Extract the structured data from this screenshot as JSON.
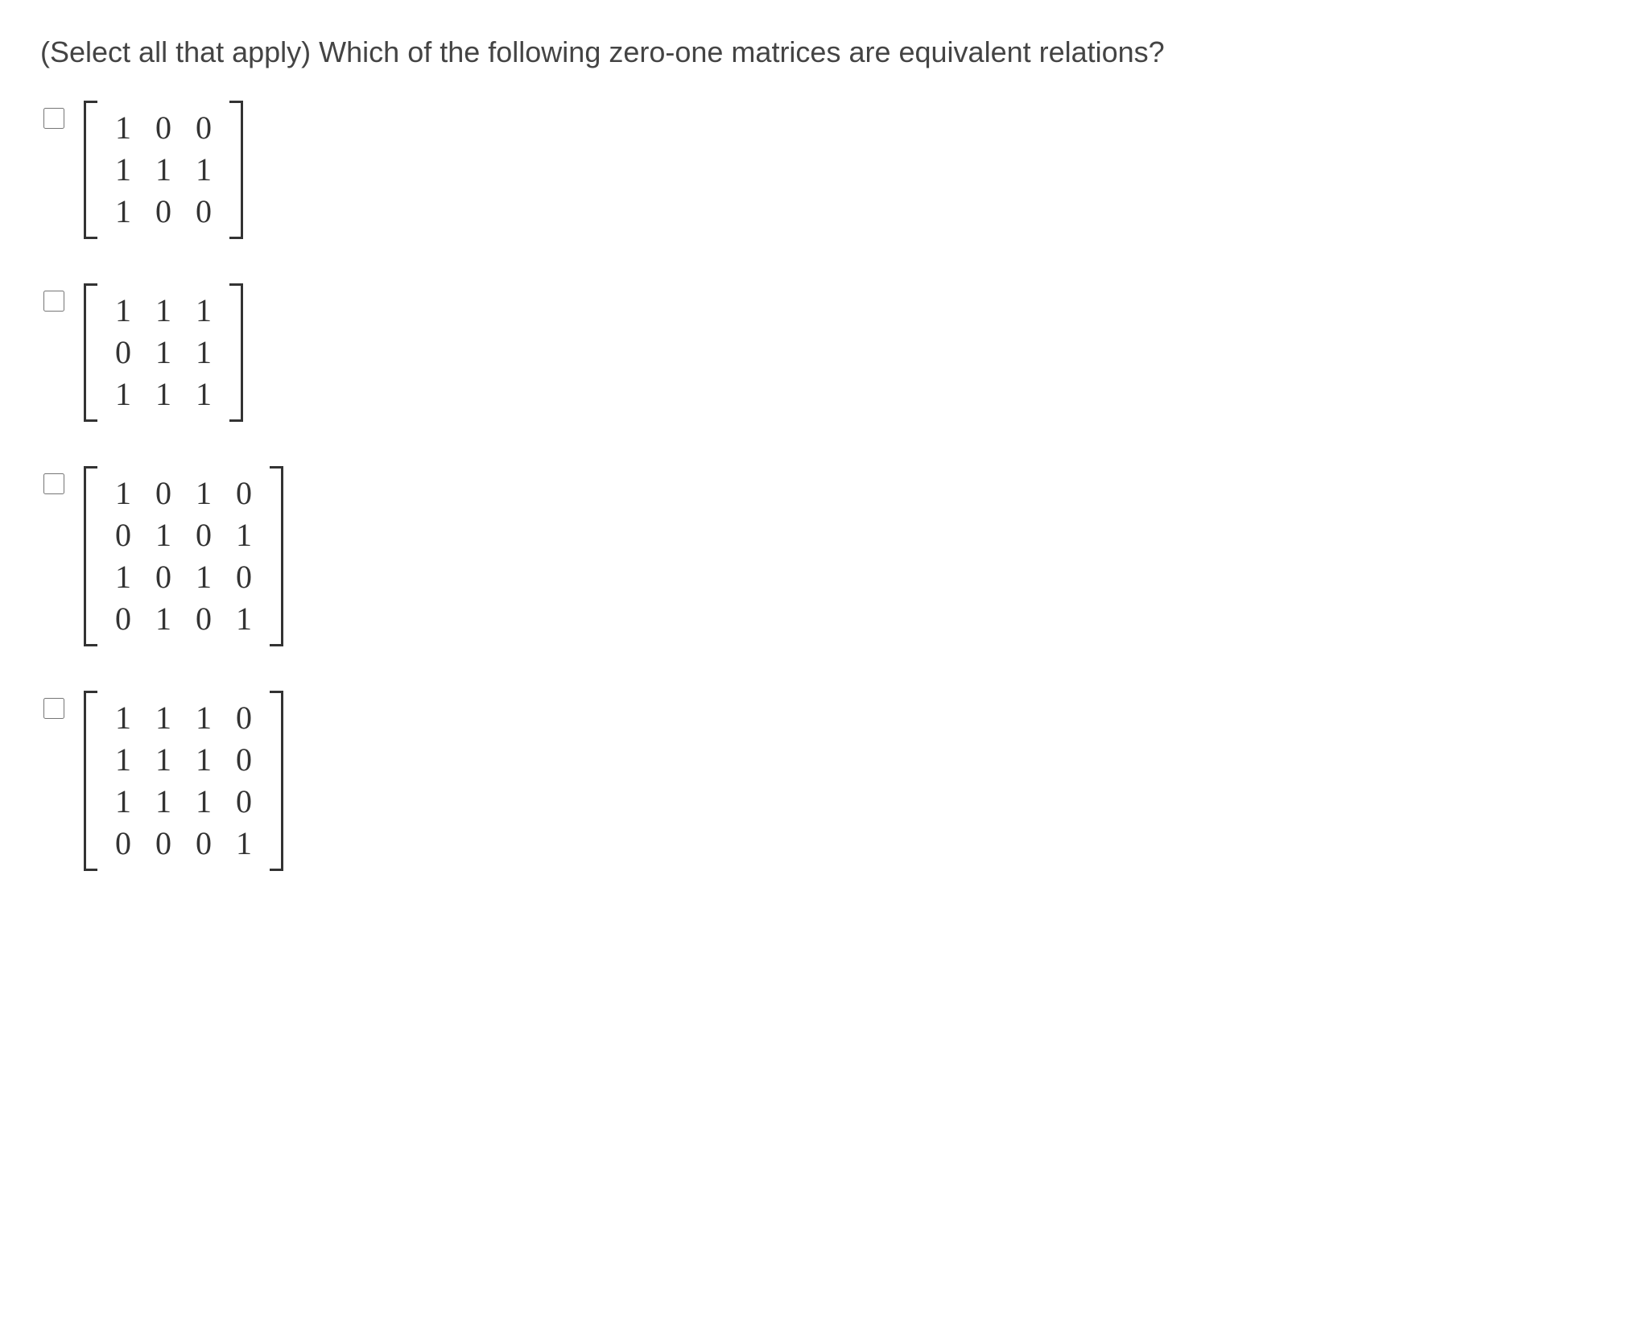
{
  "question_text": "(Select all that apply) Which of the following zero-one matrices are equivalent relations?",
  "options": [
    {
      "id": "opt1",
      "matrix": [
        [
          "1",
          "0",
          "0"
        ],
        [
          "1",
          "1",
          "1"
        ],
        [
          "1",
          "0",
          "0"
        ]
      ]
    },
    {
      "id": "opt2",
      "matrix": [
        [
          "1",
          "1",
          "1"
        ],
        [
          "0",
          "1",
          "1"
        ],
        [
          "1",
          "1",
          "1"
        ]
      ]
    },
    {
      "id": "opt3",
      "matrix": [
        [
          "1",
          "0",
          "1",
          "0"
        ],
        [
          "0",
          "1",
          "0",
          "1"
        ],
        [
          "1",
          "0",
          "1",
          "0"
        ],
        [
          "0",
          "1",
          "0",
          "1"
        ]
      ]
    },
    {
      "id": "opt4",
      "matrix": [
        [
          "1",
          "1",
          "1",
          "0"
        ],
        [
          "1",
          "1",
          "1",
          "0"
        ],
        [
          "1",
          "1",
          "1",
          "0"
        ],
        [
          "0",
          "0",
          "0",
          "1"
        ]
      ]
    }
  ]
}
